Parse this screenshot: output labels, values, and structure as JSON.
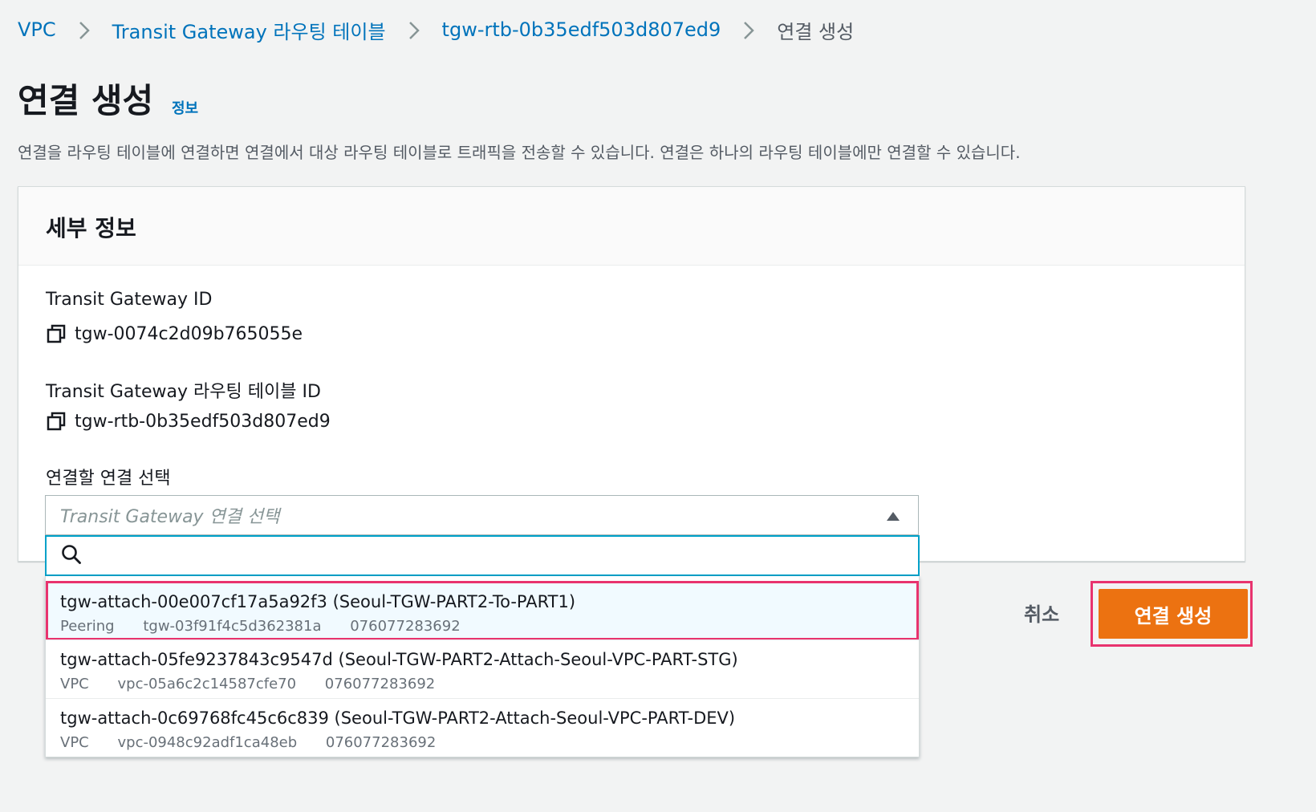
{
  "breadcrumb": {
    "items": [
      {
        "label": "VPC"
      },
      {
        "label": "Transit Gateway 라우팅 테이블"
      },
      {
        "label": "tgw-rtb-0b35edf503d807ed9"
      },
      {
        "label": "연결 생성"
      }
    ]
  },
  "page": {
    "title": "연결 생성",
    "info_link": "정보",
    "description": "연결을 라우팅 테이블에 연결하면 연결에서 대상 라우팅 테이블로 트래픽을 전송할 수 있습니다. 연결은 하나의 라우팅 테이블에만 연결할 수 있습니다."
  },
  "details": {
    "title": "세부 정보",
    "tgw_id_label": "Transit Gateway ID",
    "tgw_id_value": "tgw-0074c2d09b765055e",
    "rtb_id_label": "Transit Gateway 라우팅 테이블 ID",
    "rtb_id_value": "tgw-rtb-0b35edf503d807ed9",
    "select_label": "연결할 연결 선택",
    "select_placeholder": "Transit Gateway 연결 선택",
    "search_placeholder": ""
  },
  "options": [
    {
      "title": "tgw-attach-00e007cf17a5a92f3 (Seoul-TGW-PART2-To-PART1)",
      "type": "Peering",
      "resource": "tgw-03f91f4c5d362381a",
      "account": "076077283692"
    },
    {
      "title": "tgw-attach-05fe9237843c9547d (Seoul-TGW-PART2-Attach-Seoul-VPC-PART-STG)",
      "type": "VPC",
      "resource": "vpc-05a6c2c14587cfe70",
      "account": "076077283692"
    },
    {
      "title": "tgw-attach-0c69768fc45c6c839 (Seoul-TGW-PART2-Attach-Seoul-VPC-PART-DEV)",
      "type": "VPC",
      "resource": "vpc-0948c92adf1ca48eb",
      "account": "076077283692"
    }
  ],
  "actions": {
    "cancel_label": "취소",
    "create_label": "연결 생성"
  },
  "colors": {
    "link": "#0073bb",
    "primary_button": "#ec7211",
    "highlight": "#e8336e",
    "focus": "#00a1c9"
  }
}
